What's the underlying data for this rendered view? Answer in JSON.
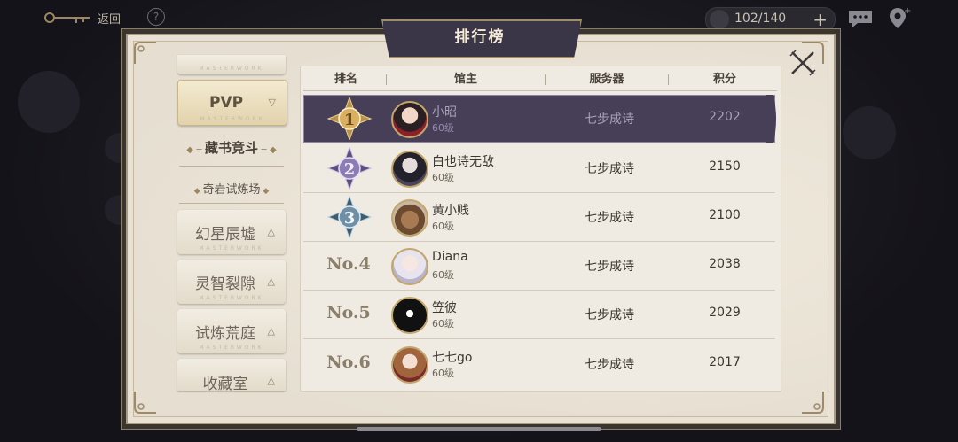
{
  "topbar": {
    "back_label": "返回",
    "help_glyph": "?",
    "stamina": "102/140",
    "plus_glyph": "+"
  },
  "modal": {
    "title": "排行榜"
  },
  "left_nav": {
    "pvp_label": "PVP",
    "masterwork_text": "MASTERWORK",
    "sub_tabs": [
      "藏书竞斗",
      "奇岩试炼场"
    ],
    "cards": [
      "幻星辰墟",
      "灵智裂隙",
      "试炼荒庭",
      "收藏室"
    ]
  },
  "table": {
    "headers": [
      "排名",
      "馆主",
      "服务器",
      "积分"
    ],
    "rows": [
      {
        "rank": "1",
        "name": "小昭",
        "level": "60级",
        "server": "七步成诗",
        "score": "2202"
      },
      {
        "rank": "2",
        "name": "白也诗无敌",
        "level": "60级",
        "server": "七步成诗",
        "score": "2150"
      },
      {
        "rank": "3",
        "name": "黄小贱",
        "level": "60级",
        "server": "七步成诗",
        "score": "2100"
      },
      {
        "rank": "No.4",
        "name": "Diana",
        "level": "60级",
        "server": "七步成诗",
        "score": "2038"
      },
      {
        "rank": "No.5",
        "name": "笠彼",
        "level": "60级",
        "server": "七步成诗",
        "score": "2029"
      },
      {
        "rank": "No.6",
        "name": "七七go",
        "level": "60级",
        "server": "七步成诗",
        "score": "2017"
      }
    ]
  },
  "colors": {
    "highlight_row": "#463f57",
    "gold": "#c2a66c",
    "panel": "#e8e1d4",
    "title_banner": "#3a3547"
  }
}
